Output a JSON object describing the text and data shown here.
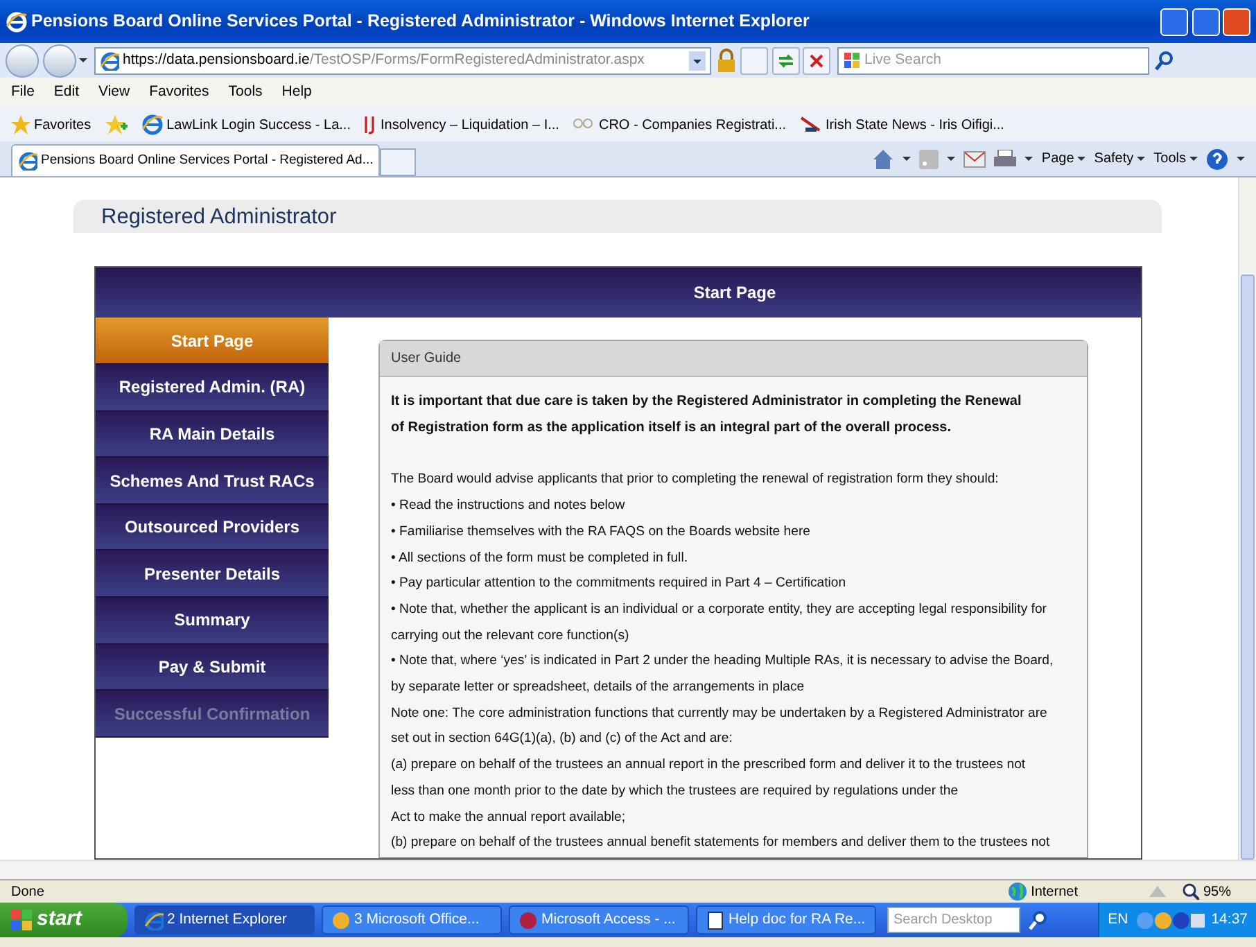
{
  "window": {
    "title": "Pensions Board Online Services Portal - Registered Administrator - Windows Internet Explorer"
  },
  "address_bar": {
    "url_prefix": "https://",
    "url_host": "data.pensionsboard.ie",
    "url_path": "/TestOSP/Forms/FormRegisteredAdministrator.aspx"
  },
  "search": {
    "placeholder": "Live Search"
  },
  "menu": [
    "File",
    "Edit",
    "View",
    "Favorites",
    "Tools",
    "Help"
  ],
  "favorites_bar": {
    "label": "Favorites",
    "links": [
      {
        "label": "LawLink  Login Success - La..."
      },
      {
        "label": "Insolvency – Liquidation – I..."
      },
      {
        "label": "CRO - Companies Registrati..."
      },
      {
        "label": "Irish State News - Iris Oifigi..."
      }
    ]
  },
  "tabs": [
    {
      "label": "Pensions Board Online Services Portal - Registered Ad...",
      "selected": true
    }
  ],
  "command_bar": [
    "Page",
    "Safety",
    "Tools"
  ],
  "page": {
    "heading": "Registered Administrator",
    "section_title": "Start Page",
    "nav": [
      {
        "label": "Start Page",
        "selected": true,
        "disabled": false
      },
      {
        "label": "Registered Admin. (RA)",
        "selected": false,
        "disabled": false
      },
      {
        "label": "RA Main Details",
        "selected": false,
        "disabled": false
      },
      {
        "label": "Schemes And Trust RACs",
        "selected": false,
        "disabled": false
      },
      {
        "label": "Outsourced Providers",
        "selected": false,
        "disabled": false
      },
      {
        "label": "Presenter Details",
        "selected": false,
        "disabled": false
      },
      {
        "label": "Summary",
        "selected": false,
        "disabled": false
      },
      {
        "label": "Pay & Submit",
        "selected": false,
        "disabled": false
      },
      {
        "label": "Successful Confirmation",
        "selected": false,
        "disabled": true
      }
    ],
    "guide": {
      "title": "User Guide",
      "paragraphs": [
        {
          "kind": "bold",
          "lines": [
            "It is important that due care is taken by the Registered Administrator in completing the Renewal",
            "of Registration form as the application itself is an integral part of the overall process."
          ]
        },
        {
          "kind": "text",
          "lines": [
            "The Board would advise applicants that prior to completing the renewal of registration form they should:"
          ]
        },
        {
          "kind": "text",
          "lines": [
            "• Read the instructions and notes below"
          ]
        },
        {
          "kind": "text",
          "lines": [
            "• Familiarise themselves with the RA FAQS on the Boards website here"
          ]
        },
        {
          "kind": "text",
          "lines": [
            "• All sections of the form must be completed in full."
          ]
        },
        {
          "kind": "text",
          "lines": [
            "• Pay particular attention to the commitments required in Part 4 – Certification"
          ]
        },
        {
          "kind": "text",
          "lines": [
            "• Note that, whether the applicant is an individual or a corporate entity, they are accepting legal responsibility for",
            "carrying out the relevant core function(s)"
          ]
        },
        {
          "kind": "text",
          "lines": [
            "• Note that, where ‘yes’ is indicated in Part 2 under the heading Multiple RAs, it is necessary to advise the Board,",
            "by separate letter or spreadsheet, details of the arrangements in place"
          ]
        },
        {
          "kind": "text",
          "lines": [
            "Note one: The core administration functions that currently may be undertaken by a Registered Administrator are",
            "set out in section 64G(1)(a), (b) and (c) of the Act and are:"
          ]
        },
        {
          "kind": "text",
          "lines": [
            "(a) prepare on behalf of the trustees an annual report in the prescribed form and deliver it to the trustees not",
            "less than one month prior to the date by which the trustees are required by regulations under the",
            "Act to make the annual report available;"
          ]
        },
        {
          "kind": "text",
          "lines": [
            "(b) prepare on behalf of the trustees annual benefit statements for members and deliver them to the trustees not"
          ]
        }
      ]
    }
  },
  "status_bar": {
    "text": "Done",
    "zone": "Internet",
    "zoom": "95%"
  },
  "taskbar": {
    "start": "start",
    "buttons": [
      {
        "label": "2 Internet Explorer",
        "selected": true
      },
      {
        "label": "3 Microsoft Office...",
        "selected": false
      },
      {
        "label": "Microsoft Access - ...",
        "selected": false
      },
      {
        "label": "Help doc for RA Re...",
        "selected": false
      }
    ],
    "search_placeholder": "Search Desktop",
    "language": "EN",
    "clock": "14:37"
  }
}
